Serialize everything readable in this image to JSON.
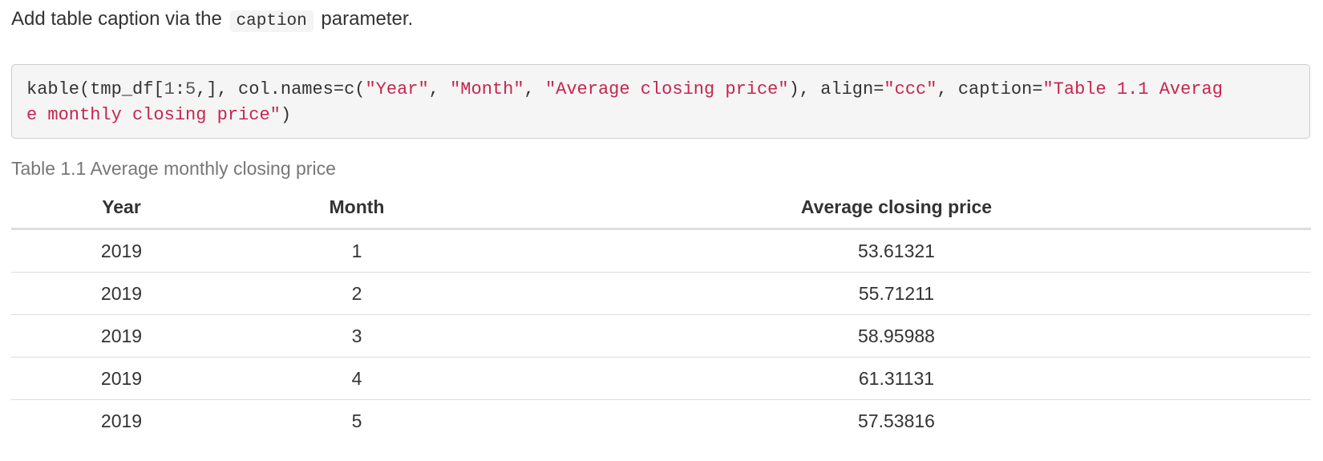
{
  "intro": {
    "before": "Add table caption via the",
    "code": "caption",
    "after": "parameter."
  },
  "code": {
    "line1": [
      {
        "t": "kable(tmp_df[",
        "k": "plain"
      },
      {
        "t": "1",
        "k": "num"
      },
      {
        "t": ":",
        "k": "plain"
      },
      {
        "t": "5",
        "k": "num"
      },
      {
        "t": ",], col.names=c(",
        "k": "plain"
      },
      {
        "t": "\"Year\"",
        "k": "str"
      },
      {
        "t": ", ",
        "k": "plain"
      },
      {
        "t": "\"Month\"",
        "k": "str"
      },
      {
        "t": ", ",
        "k": "plain"
      },
      {
        "t": "\"Average closing price\"",
        "k": "str"
      },
      {
        "t": "), align=",
        "k": "plain"
      },
      {
        "t": "\"ccc\"",
        "k": "str"
      },
      {
        "t": ", caption=",
        "k": "plain"
      },
      {
        "t": "\"Table 1.1 Averag",
        "k": "str"
      }
    ],
    "line2": [
      {
        "t": "e monthly closing price\"",
        "k": "str"
      },
      {
        "t": ")",
        "k": "plain"
      }
    ]
  },
  "table": {
    "caption": "Table 1.1 Average monthly closing price",
    "headers": [
      "Year",
      "Month",
      "Average closing price"
    ],
    "rows": [
      [
        "2019",
        "1",
        "53.61321"
      ],
      [
        "2019",
        "2",
        "55.71211"
      ],
      [
        "2019",
        "3",
        "58.95988"
      ],
      [
        "2019",
        "4",
        "61.31131"
      ],
      [
        "2019",
        "5",
        "57.53816"
      ]
    ]
  },
  "colors": {
    "string": "#c7254e",
    "caption": "#777777",
    "code_bg": "#f5f5f5"
  }
}
